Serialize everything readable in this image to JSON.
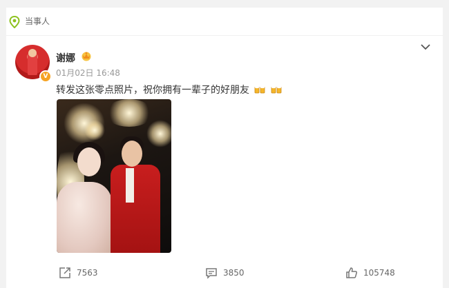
{
  "topbar": {
    "label": "当事人",
    "icon": "location-pin-icon",
    "accent": "#8dc21f"
  },
  "post": {
    "username": "谢娜",
    "timestamp": "01月02日 16:48",
    "text": "转发这张零点照片，祝你拥有一辈子的好朋友",
    "verified_badge": "V",
    "verified_color": "#f6a323",
    "emoji_icons": [
      "beer-cheers-icon",
      "beer-cheers-icon"
    ]
  },
  "actions": {
    "repost_count": "7563",
    "comment_count": "3850",
    "like_count": "105748"
  }
}
